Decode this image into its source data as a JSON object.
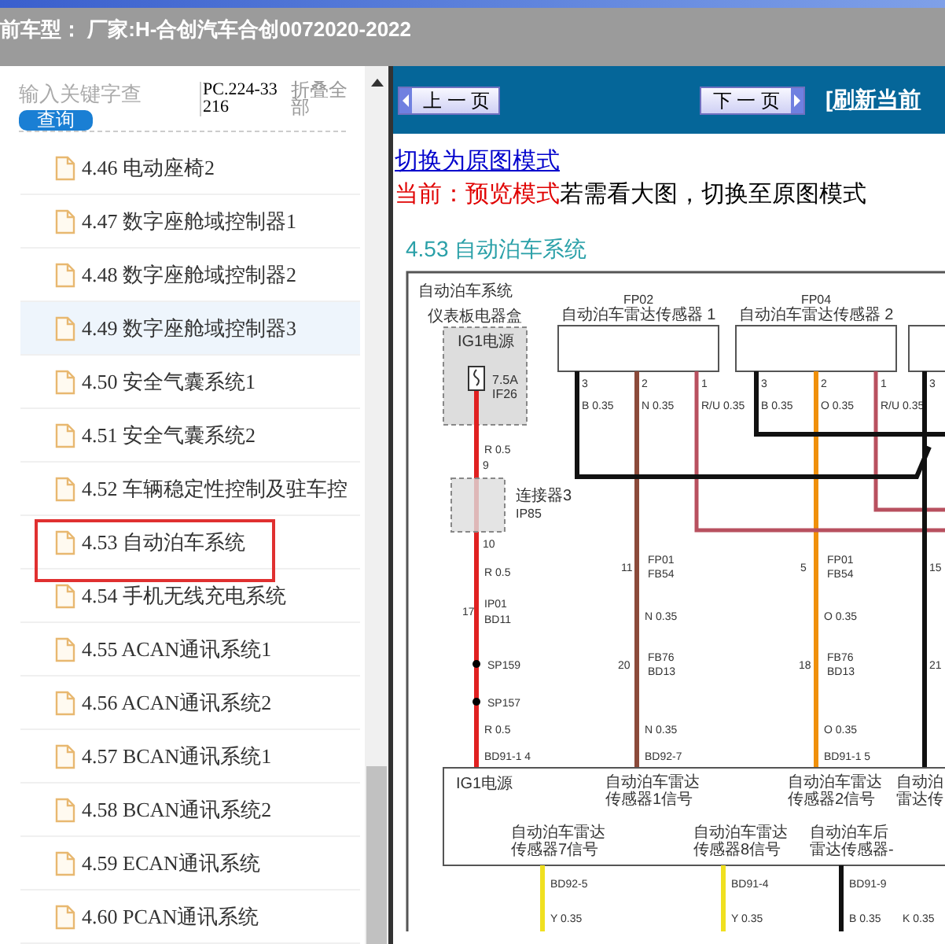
{
  "header": {
    "title": "前车型：  厂家:H-合创汽车合创0072020-2022"
  },
  "search": {
    "placeholder": "输入关键字查",
    "button": "查询",
    "code": "PC.224-33216",
    "collapse": "折叠全部"
  },
  "tree": {
    "items": [
      {
        "label": "4.46 电动座椅2",
        "selected": false,
        "marked": false
      },
      {
        "label": "4.47 数字座舱域控制器1",
        "selected": false,
        "marked": false
      },
      {
        "label": "4.48 数字座舱域控制器2",
        "selected": false,
        "marked": false
      },
      {
        "label": "4.49 数字座舱域控制器3",
        "selected": true,
        "marked": false
      },
      {
        "label": "4.50 安全气囊系统1",
        "selected": false,
        "marked": false
      },
      {
        "label": "4.51 安全气囊系统2",
        "selected": false,
        "marked": false
      },
      {
        "label": "4.52 车辆稳定性控制及驻车控",
        "selected": false,
        "marked": false
      },
      {
        "label": "4.53 自动泊车系统",
        "selected": false,
        "marked": true
      },
      {
        "label": "4.54 手机无线充电系统",
        "selected": false,
        "marked": false
      },
      {
        "label": "4.55 ACAN通讯系统1",
        "selected": false,
        "marked": false
      },
      {
        "label": "4.56 ACAN通讯系统2",
        "selected": false,
        "marked": false
      },
      {
        "label": "4.57 BCAN通讯系统1",
        "selected": false,
        "marked": false
      },
      {
        "label": "4.58 BCAN通讯系统2",
        "selected": false,
        "marked": false
      },
      {
        "label": "4.59 ECAN通讯系统",
        "selected": false,
        "marked": false
      },
      {
        "label": "4.60 PCAN通讯系统",
        "selected": false,
        "marked": false
      }
    ]
  },
  "nav": {
    "prev": "上 一 页",
    "next": "下 一 页",
    "refresh": "[刷新当前"
  },
  "content": {
    "switch_link": "切换为原图模式",
    "mode": "当前：预览模式",
    "hint": "若需看大图，切换至原图模式",
    "heading": "4.53 自动泊车系统"
  },
  "diagram": {
    "title": "自动泊车系统",
    "fuse_box_name": "仪表板电器盒",
    "power_source": "IG1电源",
    "fuse_rating": "7.5A",
    "fuse_id": "IF26",
    "connector_name": "连接器3",
    "connector_code": "IP85",
    "sensors": [
      {
        "code": "FP02",
        "name": "自动泊车雷达传感器 1",
        "pins": [
          {
            "number": "3",
            "wire": "B 0.35"
          },
          {
            "number": "2",
            "wire": "N 0.35"
          },
          {
            "number": "1",
            "wire": "R/U 0.35"
          }
        ]
      },
      {
        "code": "FP04",
        "name": "自动泊车雷达传感器 2",
        "pins": [
          {
            "number": "3",
            "wire": "B 0.35"
          },
          {
            "number": "2",
            "wire": "O 0.35"
          },
          {
            "number": "1",
            "wire": "R/U 0.35"
          }
        ]
      },
      {
        "pins": [
          {
            "number": "3"
          }
        ]
      }
    ],
    "circuit_labels": [
      "R 0.5",
      "9",
      "10",
      "R 0.5",
      "17",
      "IP01",
      "BD11",
      "SP159",
      "SP157",
      "R 0.5",
      "BD91-1 4",
      "11",
      "FP01",
      "FB54",
      "N 0.35",
      "20",
      "FB76",
      "BD13",
      "N 0.35",
      "BD92-7",
      "5",
      "FP01",
      "FB54",
      "O 0.35",
      "18",
      "FB76",
      "BD13",
      "O 0.35",
      "BD91-1 5",
      "15",
      "21"
    ],
    "module": {
      "power": "IG1电源",
      "top_inputs": [
        {
          "lines": [
            "自动泊车雷达",
            "传感器1信号"
          ]
        },
        {
          "lines": [
            "自动泊车雷达",
            "传感器2信号"
          ]
        },
        {
          "lines": [
            "自动泊",
            "雷达传"
          ]
        }
      ],
      "bottom_inputs": [
        {
          "lines": [
            "自动泊车雷达",
            "传感器7信号"
          ]
        },
        {
          "lines": [
            "自动泊车雷达",
            "传感器8信号"
          ]
        },
        {
          "lines": [
            "自动泊车后",
            "雷达传感器-"
          ]
        }
      ]
    },
    "output_labels": [
      "BD92-5",
      "BD91-4",
      "BD91-9",
      "Y 0.35",
      "Y 0.35",
      "B 0.35",
      "K 0.35"
    ]
  }
}
